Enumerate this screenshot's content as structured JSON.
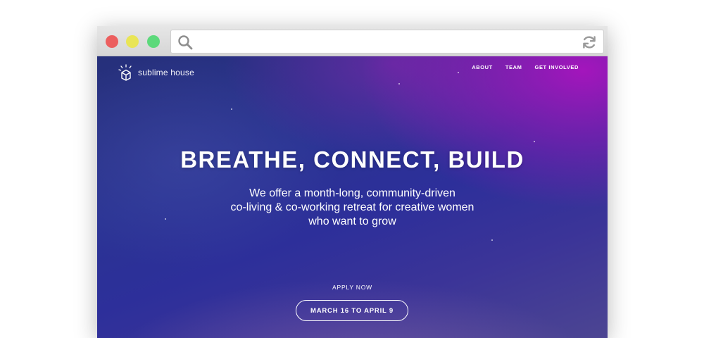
{
  "window": {
    "traffic_lights": {
      "close_color": "#ec5f5f",
      "minimize_color": "#e9e556",
      "maximize_color": "#5cd97b"
    },
    "address_bar": {
      "value": "",
      "left_icon": "search-icon",
      "right_icon": "refresh-icon"
    }
  },
  "site": {
    "brand": {
      "name": "sublime house",
      "icon": "house-icon"
    },
    "nav": {
      "items": [
        {
          "label": "ABOUT"
        },
        {
          "label": "TEAM"
        },
        {
          "label": "GET INVOLVED"
        }
      ]
    },
    "hero": {
      "title": "BREATHE, CONNECT, BUILD",
      "subtitle_lines": [
        "We offer a month-long, community-driven",
        "co-living & co-working retreat for creative women",
        "who want to grow"
      ],
      "cta_label": "APPLY NOW",
      "cta_button": "MARCH 16 TO APRIL 9"
    },
    "colors": {
      "background_top_right": "#a414be",
      "background_main": "#2a3393",
      "text": "#ffffff"
    }
  }
}
